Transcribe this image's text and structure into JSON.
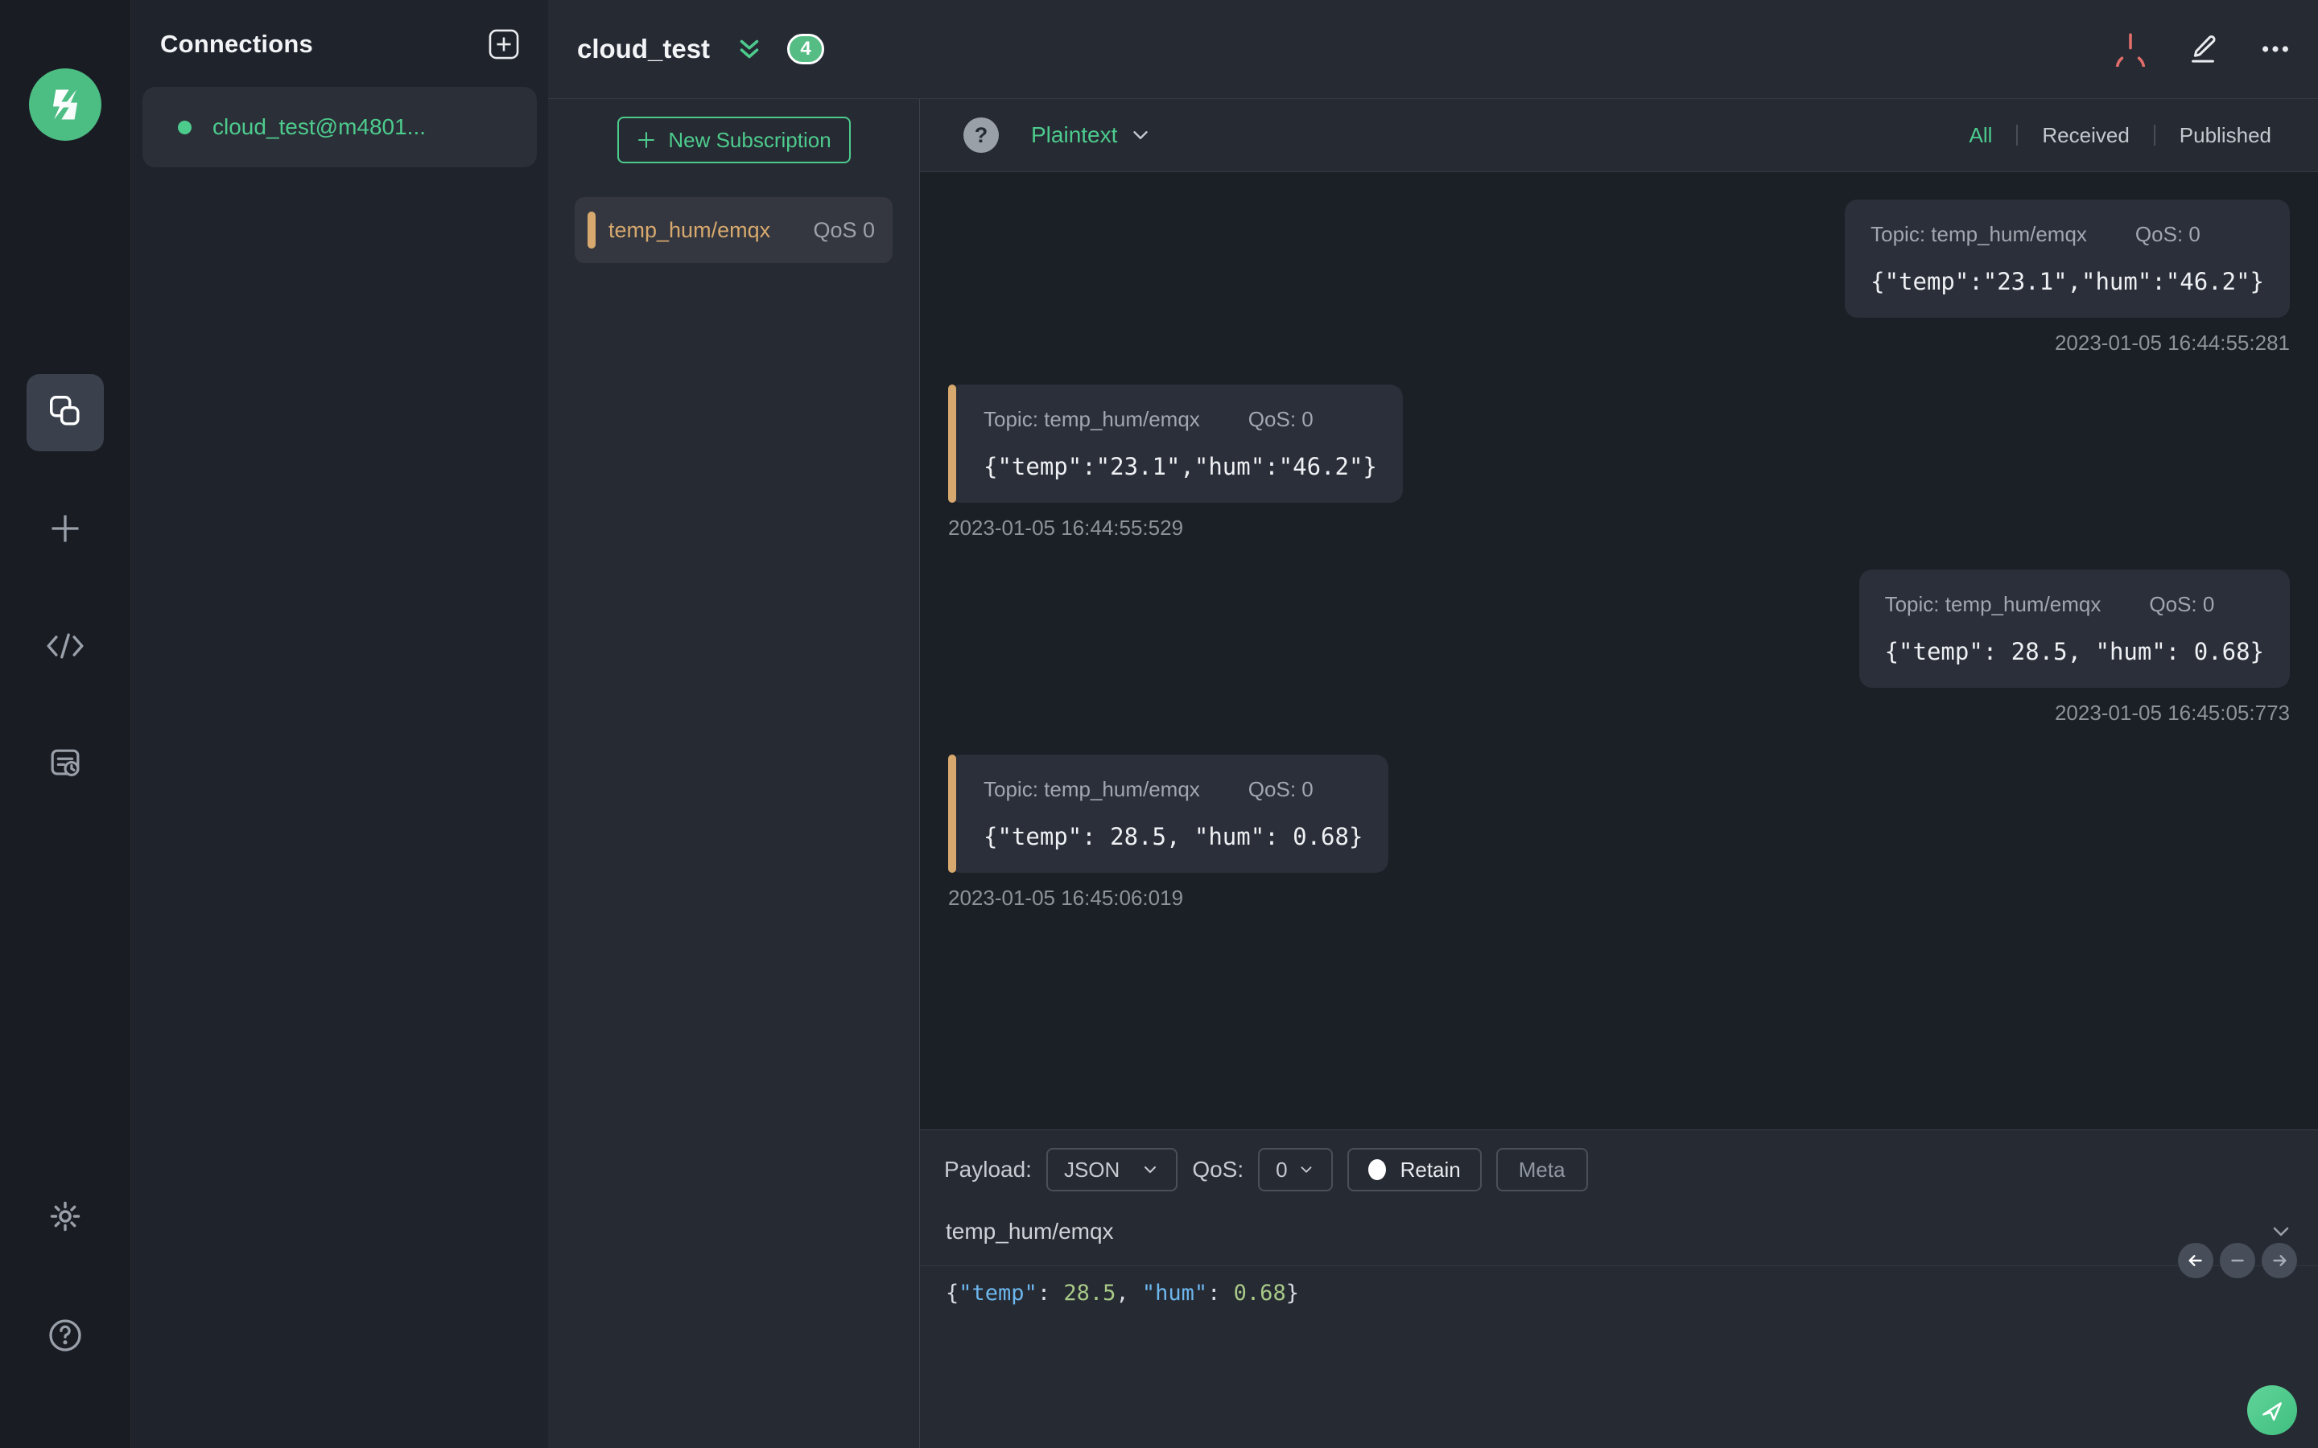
{
  "colors": {
    "accent_green": "#4dcb8d",
    "accent_orange": "#d8a96e",
    "accent_red": "#e26e6a",
    "panel_dark": "#1b1f26",
    "panel_mid": "#262a33"
  },
  "connections_panel": {
    "title": "Connections",
    "items": [
      {
        "label": "cloud_test@m4801...",
        "status": "connected"
      }
    ]
  },
  "header": {
    "title": "cloud_test",
    "message_count_badge": "4"
  },
  "subscriptions": {
    "new_subscription_label": "New Subscription",
    "items": [
      {
        "topic": "temp_hum/emqx",
        "qos": "QoS 0"
      }
    ]
  },
  "message_toolbar": {
    "help_glyph": "?",
    "format_selected": "Plaintext",
    "filters": {
      "options": [
        "All",
        "Received",
        "Published"
      ],
      "active": "All"
    }
  },
  "messages": {
    "items": [
      {
        "direction": "published",
        "topic_label": "Topic: temp_hum/emqx",
        "qos_label": "QoS: 0",
        "payload": "{\"temp\":\"23.1\",\"hum\":\"46.2\"}",
        "timestamp": "2023-01-05 16:44:55:281"
      },
      {
        "direction": "received",
        "topic_label": "Topic: temp_hum/emqx",
        "qos_label": "QoS: 0",
        "payload": "{\"temp\":\"23.1\",\"hum\":\"46.2\"}",
        "timestamp": "2023-01-05 16:44:55:529"
      },
      {
        "direction": "published",
        "topic_label": "Topic: temp_hum/emqx",
        "qos_label": "QoS: 0",
        "payload": "{\"temp\": 28.5, \"hum\": 0.68}",
        "timestamp": "2023-01-05 16:45:05:773"
      },
      {
        "direction": "received",
        "topic_label": "Topic: temp_hum/emqx",
        "qos_label": "QoS: 0",
        "payload": "{\"temp\": 28.5, \"hum\": 0.68}",
        "timestamp": "2023-01-05 16:45:06:019"
      }
    ]
  },
  "publish": {
    "payload_label": "Payload:",
    "payload_format": "JSON",
    "qos_label": "QoS:",
    "qos_value": "0",
    "retain_label": "Retain",
    "meta_label": "Meta",
    "topic_value": "temp_hum/emqx",
    "payload_tokens": [
      {
        "text": "{",
        "type": "punct"
      },
      {
        "text": "\"temp\"",
        "type": "key"
      },
      {
        "text": ": ",
        "type": "punct"
      },
      {
        "text": "28.5",
        "type": "num"
      },
      {
        "text": ", ",
        "type": "punct"
      },
      {
        "text": "\"hum\"",
        "type": "key"
      },
      {
        "text": ": ",
        "type": "punct"
      },
      {
        "text": "0.68",
        "type": "num"
      },
      {
        "text": "}",
        "type": "punct"
      }
    ]
  }
}
